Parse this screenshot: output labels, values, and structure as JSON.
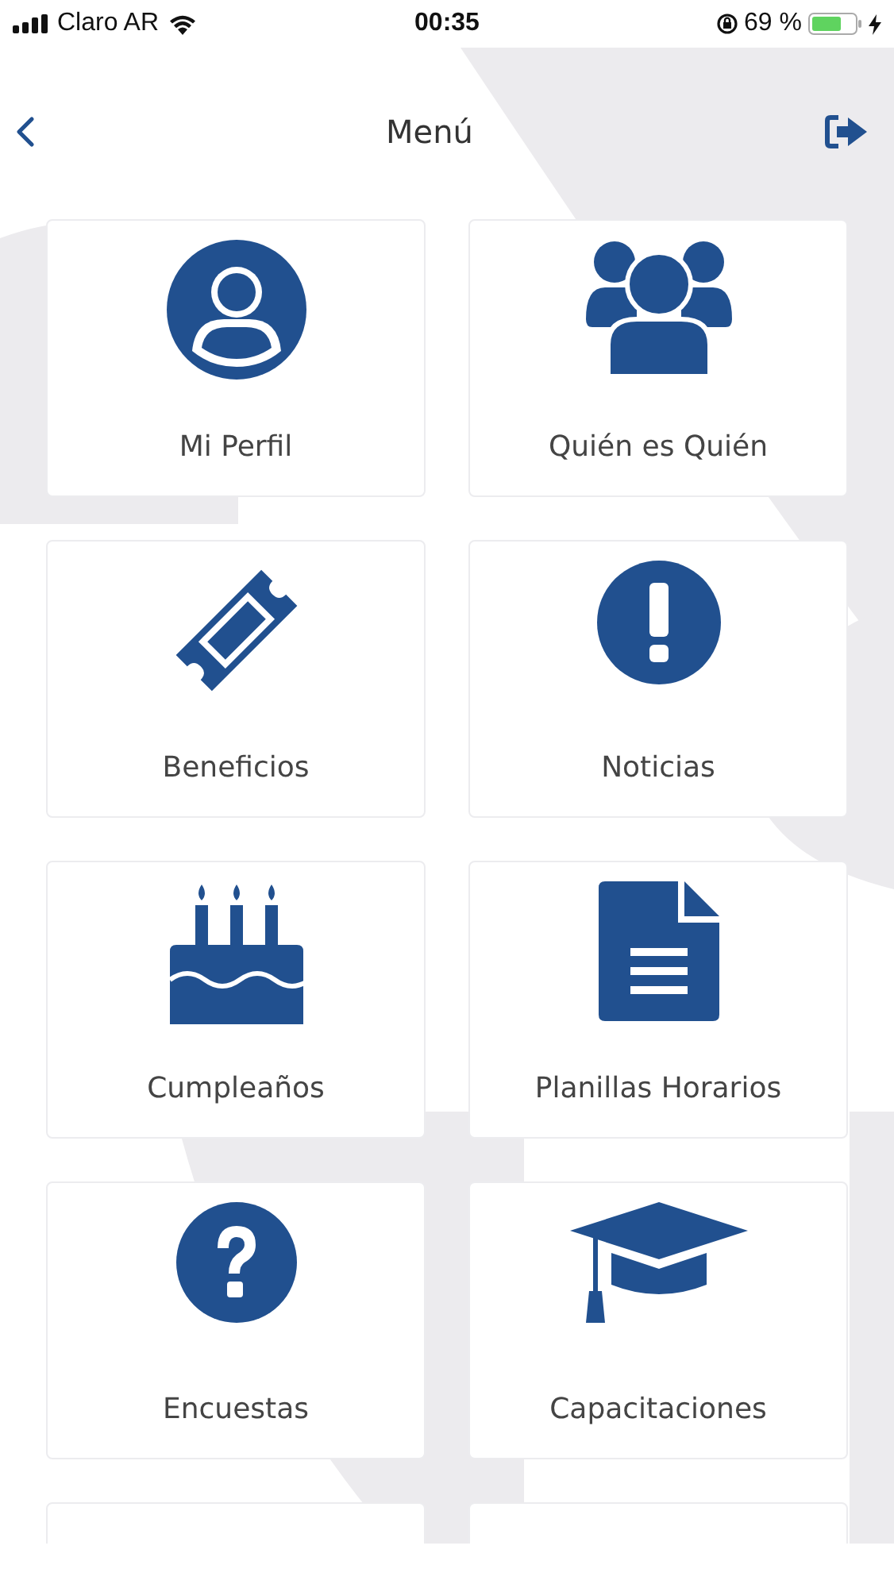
{
  "status_bar": {
    "carrier": "Claro AR",
    "time": "00:35",
    "battery": "69 %"
  },
  "header": {
    "title": "Menú"
  },
  "menu_items": [
    {
      "label": "Mi Perfil"
    },
    {
      "label": "Quién es Quién"
    },
    {
      "label": "Beneficios"
    },
    {
      "label": "Noticias"
    },
    {
      "label": "Cumpleaños"
    },
    {
      "label": "Planillas Horarios"
    },
    {
      "label": "Encuestas"
    },
    {
      "label": "Capacitaciones"
    }
  ]
}
